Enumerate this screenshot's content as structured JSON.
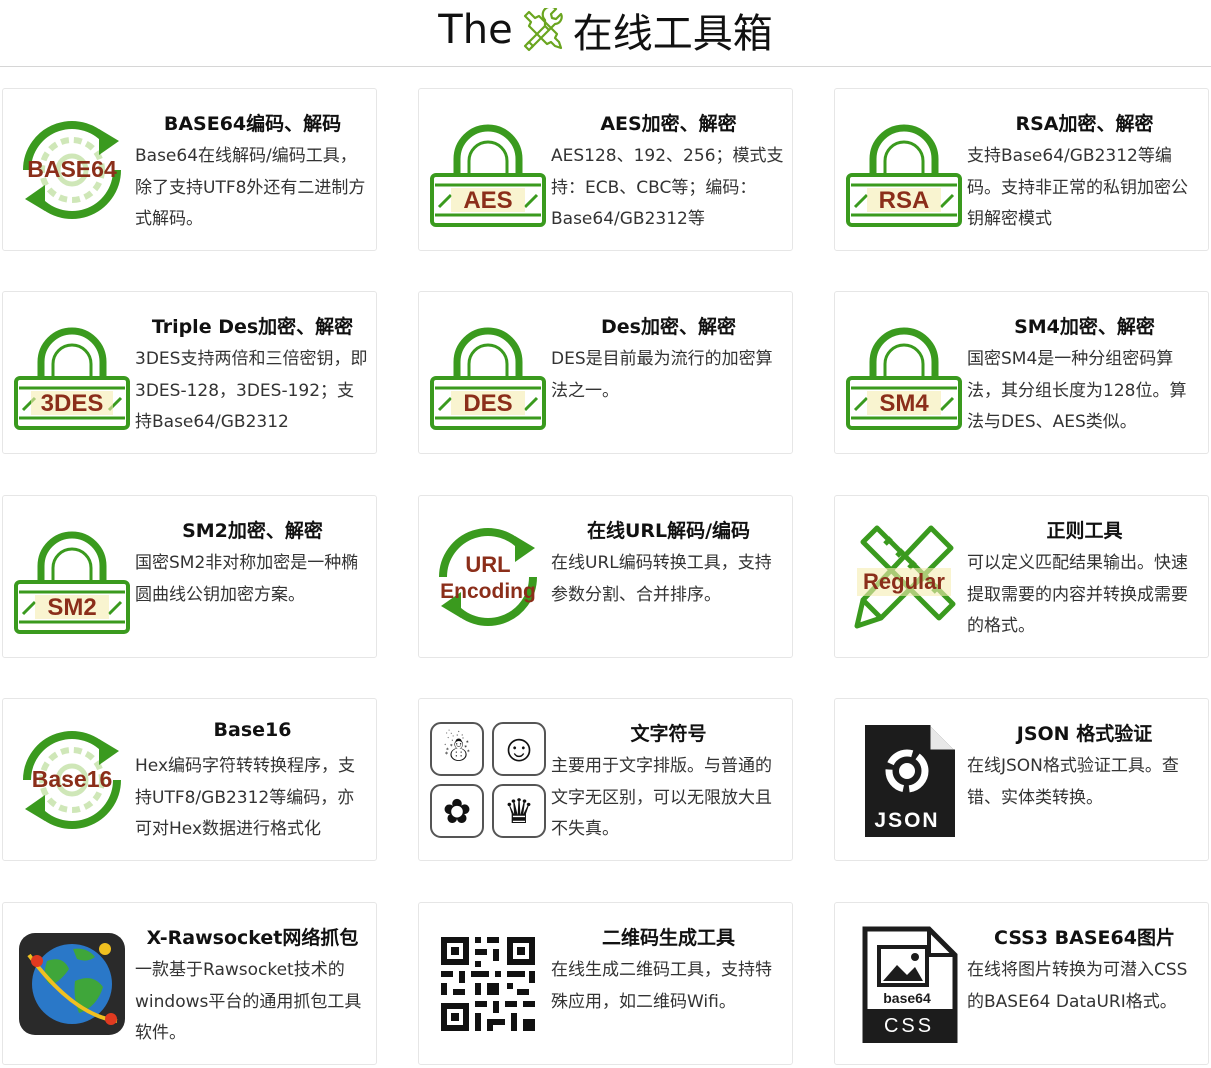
{
  "header": {
    "prefix": "The",
    "icon": "tools-icon",
    "title": "在线工具箱"
  },
  "colors": {
    "icon_green": "#3a9a1e",
    "icon_label": "#8b2e1a",
    "icon_label_bg": "#f5ecb0",
    "border": "#e6e6e6"
  },
  "cards": [
    {
      "title": "BASE64编码、解码",
      "desc": "Base64在线解码/编码工具，除了支持UTF8外还有二进制方式解码。",
      "icon": "refresh-gear-icon",
      "icon_label": "BASE64"
    },
    {
      "title": "AES加密、解密",
      "desc": "AES128、192、256；模式支持：ECB、CBC等；编码：Base64/GB2312等",
      "icon": "padlock-icon",
      "icon_label": "AES"
    },
    {
      "title": "RSA加密、解密",
      "desc": "支持Base64/GB2312等编码。支持非正常的私钥加密公钥解密模式",
      "icon": "padlock-icon",
      "icon_label": "RSA"
    },
    {
      "title": "Triple Des加密、解密",
      "desc": "3DES支持两倍和三倍密钥，即3DES-128，3DES-192；支持Base64/GB2312",
      "icon": "padlock-icon",
      "icon_label": "3DES"
    },
    {
      "title": "Des加密、解密",
      "desc": "DES是目前最为流行的加密算法之一。",
      "icon": "padlock-icon",
      "icon_label": "DES"
    },
    {
      "title": "SM4加密、解密",
      "desc": "国密SM4是一种分组密码算法，其分组长度为128位。算法与DES、AES类似。",
      "icon": "padlock-icon",
      "icon_label": "SM4"
    },
    {
      "title": "SM2加密、解密",
      "desc": "国密SM2非对称加密是一种椭圆曲线公钥加密方案。",
      "icon": "padlock-icon",
      "icon_label": "SM2"
    },
    {
      "title": "在线URL解码/编码",
      "desc": "在线URL编码转换工具，支持参数分割、合并排序。",
      "icon": "refresh-icon",
      "icon_label": "URL",
      "icon_label2": "Encoding"
    },
    {
      "title": "正则工具",
      "desc": "可以定义匹配结果输出。快速提取需要的内容并转换成需要的格式。",
      "icon": "ruler-pencil-icon",
      "icon_label": "Regular"
    },
    {
      "title": "Base16",
      "desc": "Hex编码字符转转换程序，支持UTF8/GB2312等编码，亦可对Hex数据进行格式化",
      "icon": "refresh-gear-icon",
      "icon_label": "Base16"
    },
    {
      "title": "文字符号",
      "desc": "主要用于文字排版。与普通的文字无区别，可以无限放大且不失真。",
      "icon": "symbols-icon",
      "glyphs": [
        "☃",
        "☺",
        "✿",
        "♛"
      ]
    },
    {
      "title": "JSON 格式验证",
      "desc": "在线JSON格式验证工具。查错、实体类转换。",
      "icon": "json-file-icon",
      "icon_label": "JSON"
    },
    {
      "title": "X-Rawsocket网络抓包",
      "desc": "一款基于Rawsocket技术的windows平台的通用抓包工具软件。",
      "icon": "globe-icon"
    },
    {
      "title": "二维码生成工具",
      "desc": "在线生成二维码工具，支持特殊应用，如二维码Wifi。",
      "icon": "qr-code-icon"
    },
    {
      "title": "CSS3 BASE64图片",
      "desc": "在线将图片转换为可潜入CSS的BASE64 DataURI格式。",
      "icon": "css-file-icon",
      "icon_label": "base64",
      "icon_label2": "CSS"
    }
  ]
}
